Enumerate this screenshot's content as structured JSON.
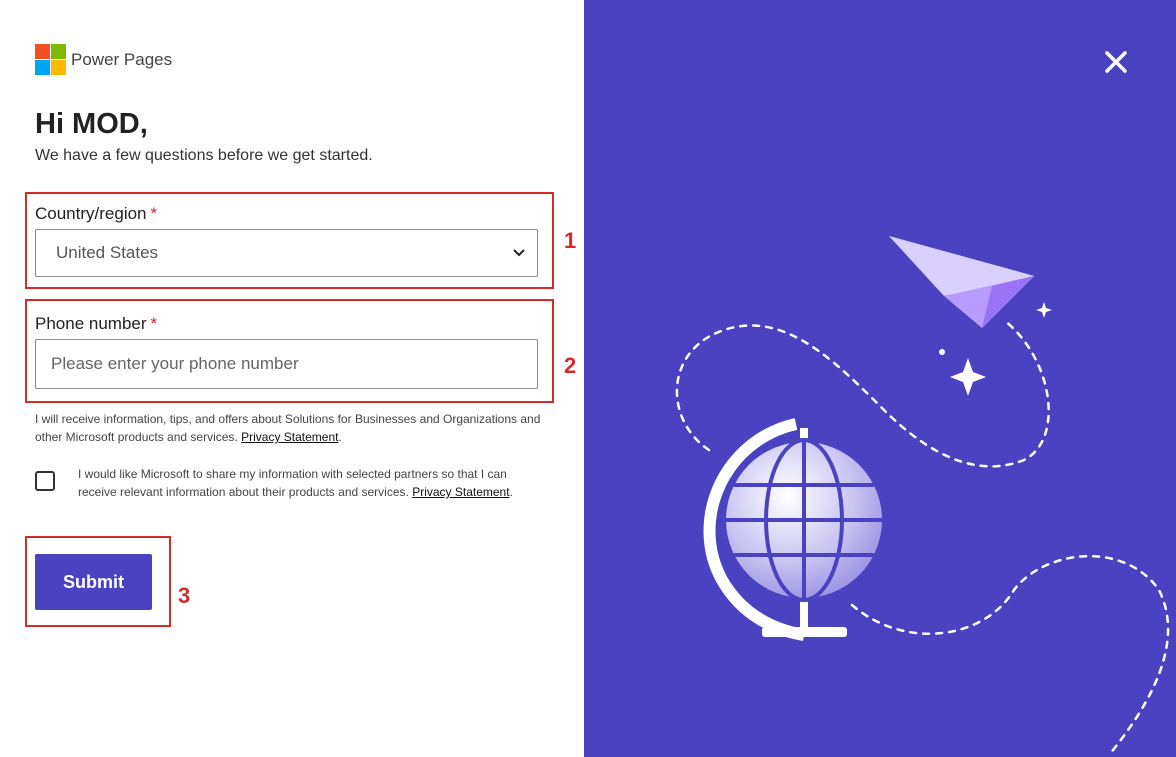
{
  "brand": {
    "name": "Power Pages",
    "logo_colors": [
      "#f25022",
      "#7fba00",
      "#00a4ef",
      "#ffb900"
    ]
  },
  "header": {
    "greeting": "Hi MOD,",
    "subtitle": "We have a few questions before we get started."
  },
  "form": {
    "country": {
      "label": "Country/region",
      "required_mark": "*",
      "selected_value": "United States"
    },
    "phone": {
      "label": "Phone number",
      "required_mark": "*",
      "placeholder": "Please enter your phone number",
      "value": ""
    },
    "consent_text": "I will receive information, tips, and offers about Solutions for Businesses and Organizations and other Microsoft products and services.",
    "consent_link": "Privacy Statement",
    "share_checkbox": {
      "checked": false,
      "text": "I would like Microsoft to share my information with selected partners so that I can receive relevant information about their products and services.",
      "link": "Privacy Statement"
    },
    "submit_label": "Submit"
  },
  "annotations": {
    "step1": "1",
    "step2": "2",
    "step3": "3",
    "color": "#d42b2b"
  },
  "theme": {
    "accent": "#4a42c0",
    "panel_background": "#4a42c0"
  },
  "icons": {
    "close": "close-icon",
    "dropdown": "chevron-down-icon",
    "illustration": "globe-paper-plane-illustration"
  }
}
